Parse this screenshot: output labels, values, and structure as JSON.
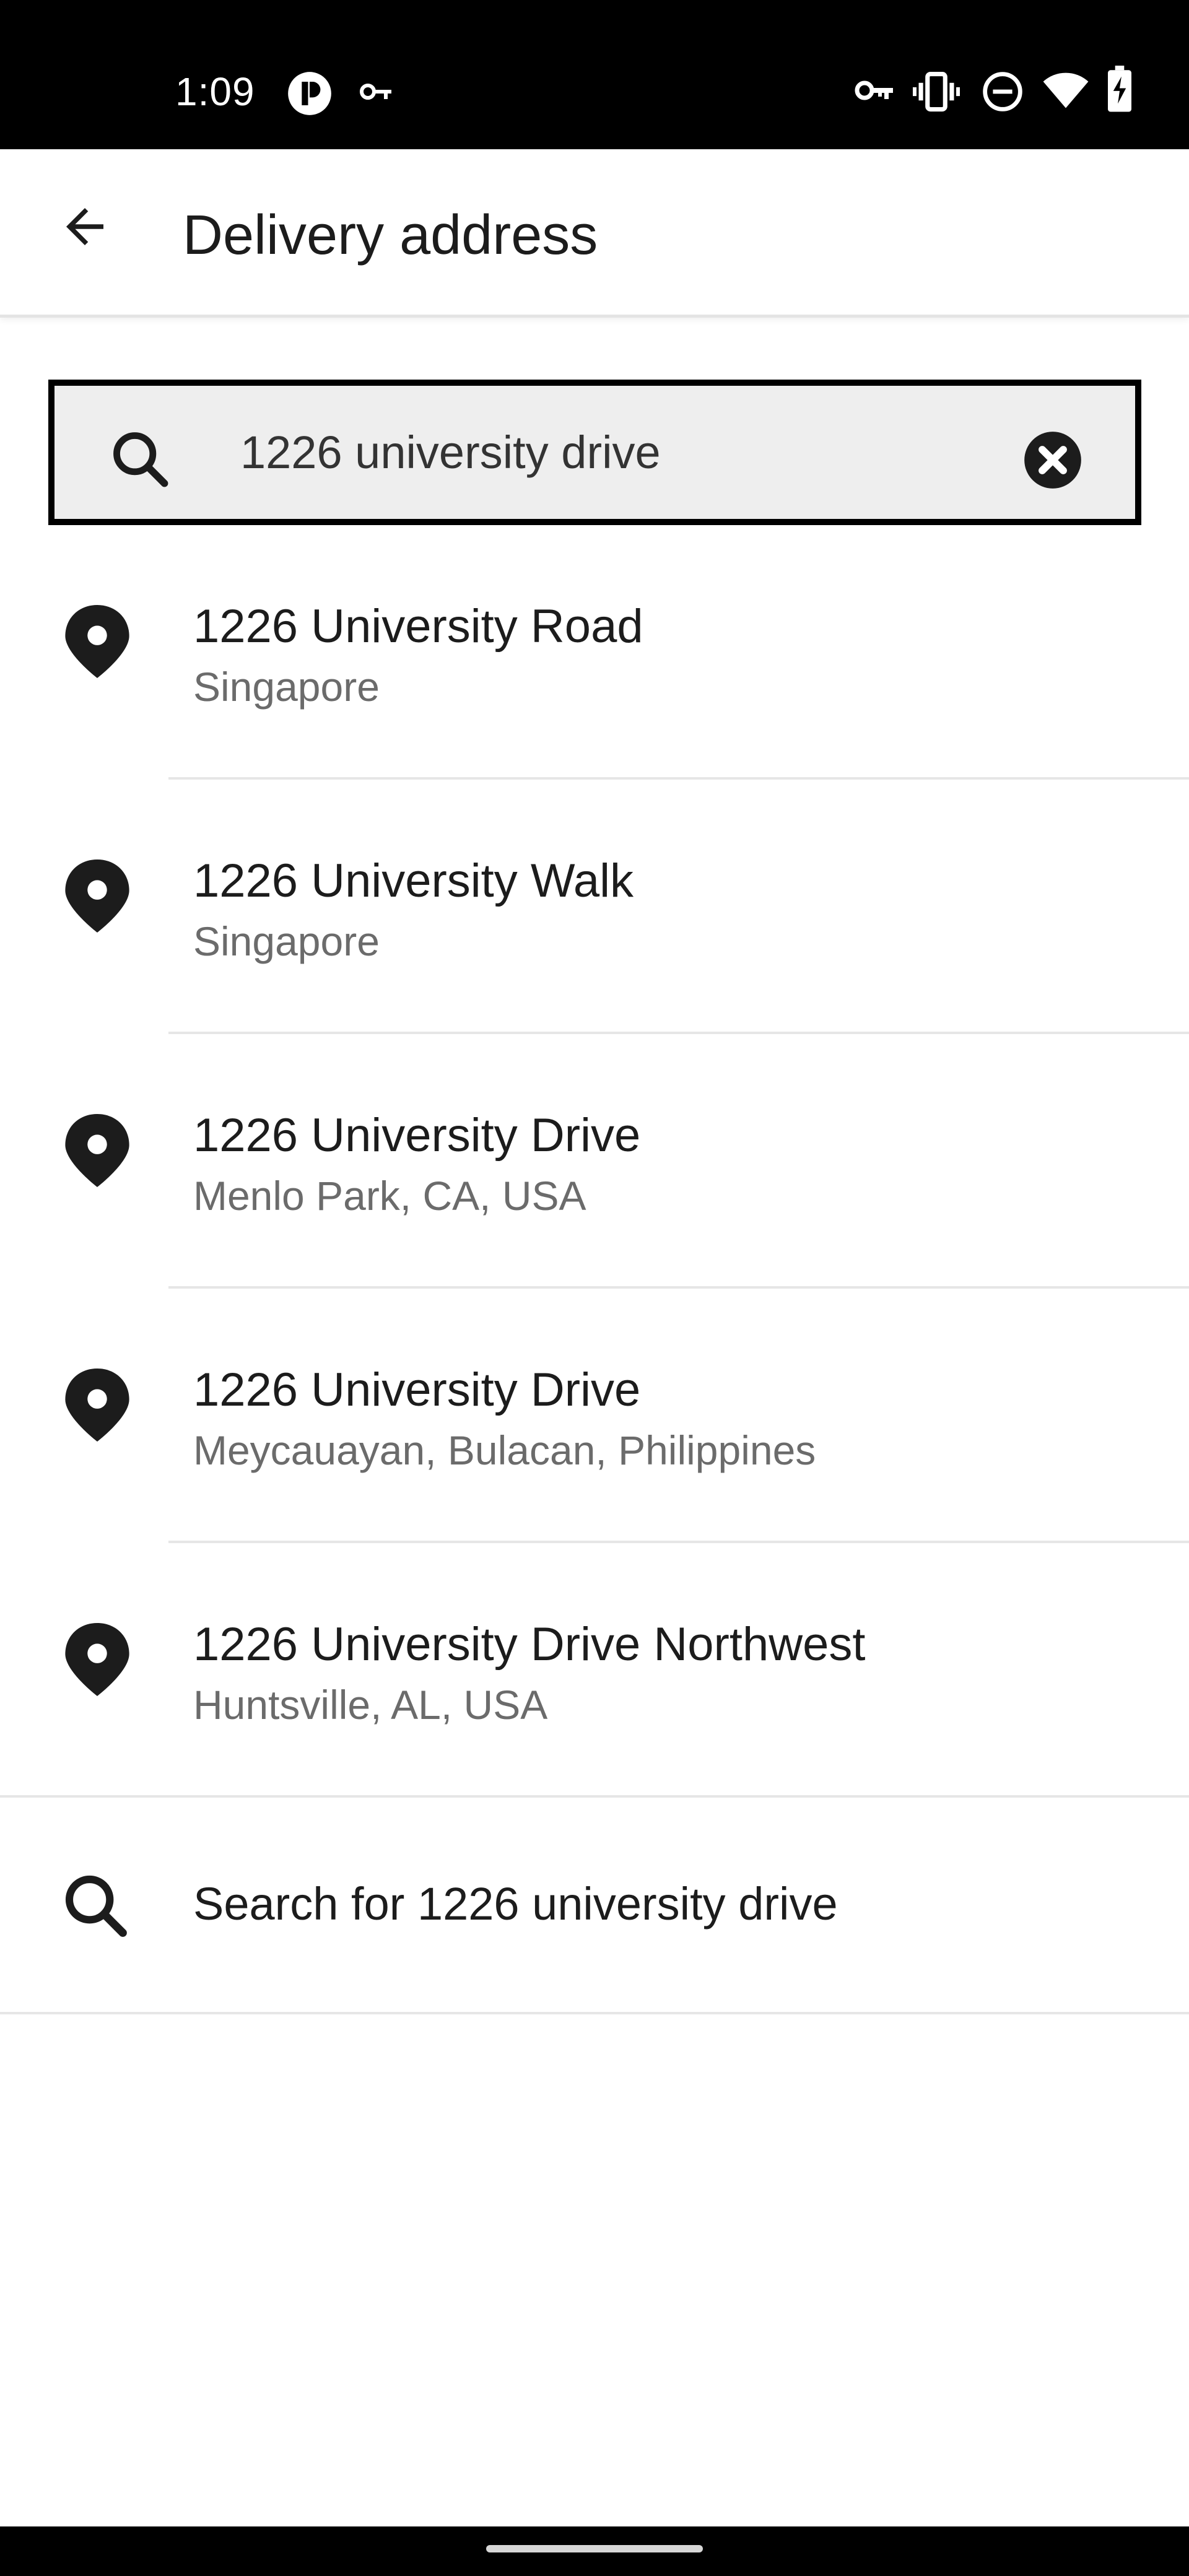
{
  "status_bar": {
    "time": "1:09",
    "icons": [
      "app-notification-icon",
      "vpn-key-icon",
      "key-icon",
      "vibrate-icon",
      "do-not-disturb-icon",
      "wifi-icon",
      "battery-charging-icon"
    ]
  },
  "header": {
    "back_icon": "arrow-left-icon",
    "title": "Delivery address"
  },
  "search": {
    "value": "1226 university drive",
    "search_icon": "search-icon",
    "clear_icon": "clear-circle-icon"
  },
  "results": [
    {
      "title": "1226 University Road",
      "subtitle": "Singapore",
      "icon": "location-pin-icon"
    },
    {
      "title": "1226 University Walk",
      "subtitle": "Singapore",
      "icon": "location-pin-icon"
    },
    {
      "title": "1226 University Drive",
      "subtitle": "Menlo Park, CA, USA",
      "icon": "location-pin-icon"
    },
    {
      "title": "1226 University Drive",
      "subtitle": "Meycauayan, Bulacan, Philippines",
      "icon": "location-pin-icon"
    },
    {
      "title": "1226 University Drive Northwest",
      "subtitle": "Huntsville, AL, USA",
      "icon": "location-pin-icon"
    }
  ],
  "search_for": {
    "label": "Search for 1226 university drive",
    "icon": "search-icon"
  },
  "colors": {
    "status_bar_bg": "#000000",
    "text_primary": "#1c1c1c",
    "text_secondary": "#6b6b6b",
    "search_bg": "#eeeeee",
    "search_border": "#000000",
    "divider": "#e6e6e6"
  }
}
